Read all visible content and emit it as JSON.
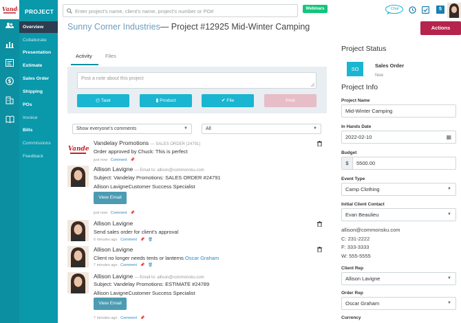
{
  "brand": {
    "accent": "#0b8fa1",
    "nav_bg": "#0a98ab",
    "active_bg": "#2c3e50",
    "actions_color": "#b4244c",
    "button_color": "#1ab5d1"
  },
  "nav": {
    "title": "PROJECT",
    "items": [
      {
        "label": "Overview"
      },
      {
        "label": "Collaborate"
      },
      {
        "label": "Presentation"
      },
      {
        "label": "Estimate"
      },
      {
        "label": "Sales Order"
      },
      {
        "label": "Shipping"
      },
      {
        "label": "POs"
      },
      {
        "label": "Invoice"
      },
      {
        "label": "Bills"
      },
      {
        "label": "Commissions"
      },
      {
        "label": "Feedback"
      }
    ],
    "icons": [
      "people-icon",
      "chart-icon",
      "report-icon",
      "dollar-icon",
      "building-icon",
      "book-icon"
    ]
  },
  "topbar": {
    "search_placeholder": "Enter project's name, client's name, project's number or PO#",
    "webinars_label": "Webinars",
    "chat_label": "Chat",
    "badge_count": "5"
  },
  "header": {
    "client": "Sunny Corner Industries",
    "project": "— Project #12925 Mid-Winter Camping",
    "actions_label": "Actions"
  },
  "tabs": {
    "activity": "Activity",
    "files": "Files"
  },
  "note": {
    "placeholder": "Post a note about this project",
    "buttons": {
      "task": "Task",
      "product": "Product",
      "file": "File",
      "post": "Post"
    }
  },
  "filters": {
    "comments": "Show everyone's comments",
    "type": "All"
  },
  "feed": {
    "comment_label": "Comment",
    "items": [
      {
        "name": "Vandelay Promotions",
        "tag": "— SALES ORDER (24791)",
        "line1": "Order approved by Chuck: This is perfect",
        "time": "just now"
      },
      {
        "name": "Allison Lavigne",
        "tag": "— Email to: allison@commonsku.com",
        "line1": "Subject: Vandelay Promotions: SALES ORDER #24791",
        "line2": "Allison LavigneCustomer Success Specialist",
        "button": "View Email",
        "time": "just now"
      },
      {
        "name": "Allison Lavigne",
        "line1": "Send sales order for client's approval",
        "time": "6 minutes ago"
      },
      {
        "name": "Allison Lavigne",
        "line1": "Client no longer needs tents or lanterns",
        "mention": "Oscar Graham",
        "time": "7 minutes ago"
      },
      {
        "name": "Allison Lavigne",
        "tag": "— Email to: allison@commonsku.com",
        "line1": "Subject: Vandelay Promotions: ESTIMATE #24789",
        "line2": "Allison LavigneCustomer Success Specialist",
        "button": "View Email",
        "time": "7 minutes ago"
      }
    ]
  },
  "status": {
    "heading": "Project Status",
    "badge": "SO",
    "label": "Sales Order",
    "sub": "New"
  },
  "info": {
    "heading": "Project Info",
    "project_name_label": "Project Name",
    "project_name": "Mid-Winter Camping",
    "in_hands_label": "In Hands Date",
    "in_hands": "2022-02-10",
    "budget_label": "Budget",
    "budget_currency": "$",
    "budget": "5500.00",
    "event_type_label": "Event Type",
    "event_type": "Camp Clothing",
    "contact_label": "Initial Client Contact",
    "contact": "Evan Beaulieu",
    "email": "allison@commonsku.com",
    "phone_c": "C: 231-2222",
    "phone_f": "F: 333-3333",
    "phone_w": "W: 555-5555",
    "client_rep_label": "Client Rep",
    "client_rep": "Allison Lavigne",
    "order_rep_label": "Order Rep",
    "order_rep": "Oscar Graham",
    "currency_label": "Currency"
  }
}
